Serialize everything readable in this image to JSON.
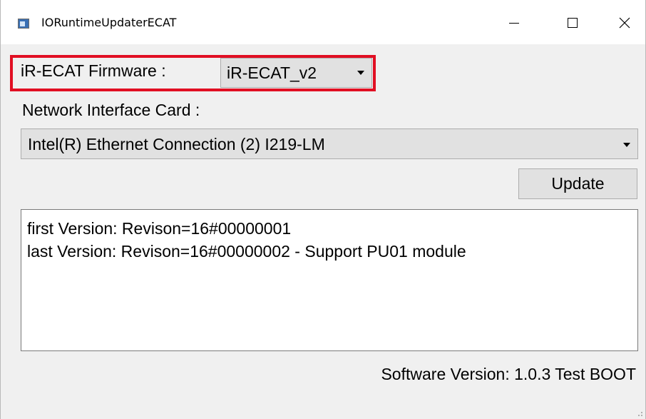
{
  "window": {
    "title": "IORuntimeUpdaterECAT"
  },
  "title_controls": {
    "minimize_icon": "minimize-icon",
    "maximize_icon": "maximize-icon",
    "close_icon": "close-icon"
  },
  "firmware": {
    "label": "iR-ECAT Firmware :",
    "selected": "iR-ECAT_v2",
    "highlight_color": "#e10f23"
  },
  "nic": {
    "label": "Network Interface Card :",
    "selected": "Intel(R) Ethernet Connection (2) I219-LM"
  },
  "actions": {
    "update_label": "Update"
  },
  "log": {
    "lines": [
      "first Version:  Revison=16#00000001",
      "last Version:  Revison=16#00000002 - Support PU01 module"
    ]
  },
  "footer": {
    "software_version": "Software Version: 1.0.3 Test BOOT"
  }
}
